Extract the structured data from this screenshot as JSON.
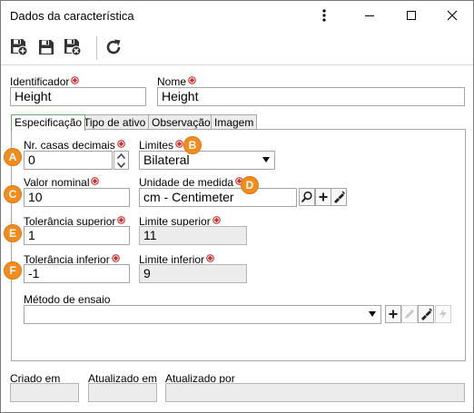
{
  "window": {
    "title": "Dados da característica"
  },
  "fields": {
    "identificador": {
      "label": "Identificador",
      "value": "Height"
    },
    "nome": {
      "label": "Nome",
      "value": "Height"
    }
  },
  "tabs": [
    {
      "label": "Especificação",
      "active": true
    },
    {
      "label": "Tipo de ativo",
      "active": false
    },
    {
      "label": "Observação",
      "active": false
    },
    {
      "label": "Imagem",
      "active": false
    }
  ],
  "spec": {
    "nr_casas": {
      "label": "Nr. casas decimais",
      "value": "0"
    },
    "limites": {
      "label": "Limites",
      "value": "Bilateral"
    },
    "valor_nominal": {
      "label": "Valor nominal",
      "value": "10"
    },
    "unidade": {
      "label": "Unidade de medida",
      "value": "cm - Centimeter"
    },
    "tol_sup": {
      "label": "Tolerância superior",
      "value": "1"
    },
    "lim_sup": {
      "label": "Limite superior",
      "value": "11"
    },
    "tol_inf": {
      "label": "Tolerância inferior",
      "value": "-1"
    },
    "lim_inf": {
      "label": "Limite inferior",
      "value": "9"
    },
    "metodo": {
      "label": "Método de ensaio",
      "value": ""
    }
  },
  "markers": [
    "A",
    "B",
    "C",
    "D",
    "E",
    "F"
  ],
  "footer": {
    "criado": {
      "label": "Criado em",
      "value": ""
    },
    "atualizado_em": {
      "label": "Atualizado em",
      "value": ""
    },
    "atualizado_por": {
      "label": "Atualizado por",
      "value": ""
    }
  },
  "icons": {
    "save_new": "save-new-icon",
    "save": "save-icon",
    "save_close": "save-close-icon",
    "refresh": "refresh-icon",
    "search": "search-icon",
    "add": "plus-icon",
    "clear": "eraser-icon",
    "edit": "pencil-icon",
    "lightning": "lightning-icon"
  },
  "colors": {
    "marker": "#f28c1e",
    "required": "#d12b2b",
    "active_tab_border": "#6fa76f"
  }
}
